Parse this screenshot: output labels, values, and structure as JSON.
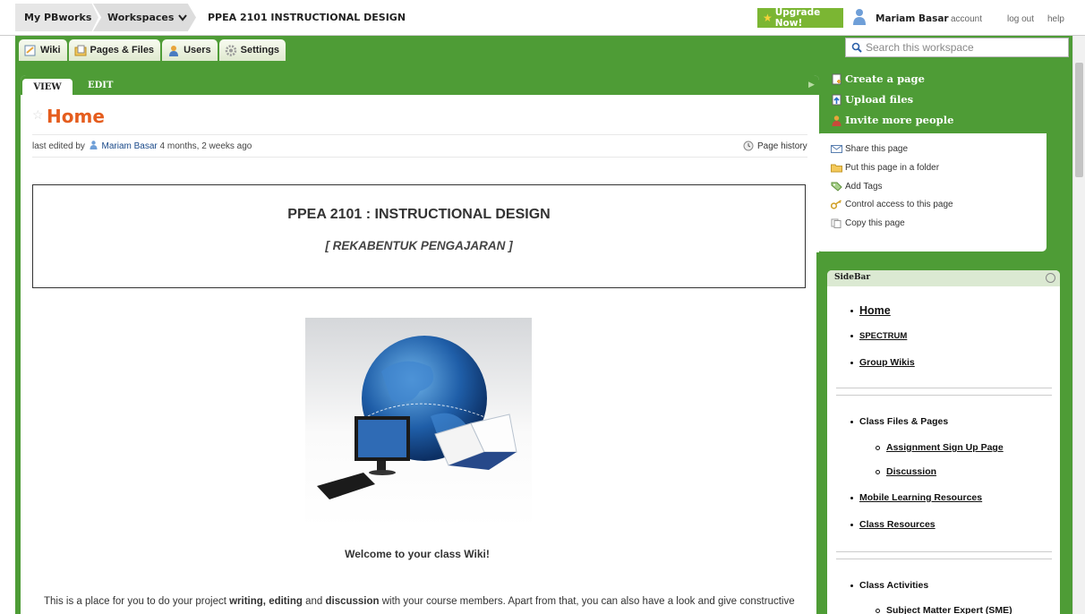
{
  "topbar": {
    "my_pbworks": "My PBworks",
    "workspaces": "Workspaces",
    "current_workspace": "PPEA 2101 INSTRUCTIONAL DESIGN",
    "upgrade": "Upgrade Now!",
    "user_name": "Mariam Basar",
    "links": {
      "account": "account",
      "logout": "log out",
      "help": "help"
    }
  },
  "nav_tabs": [
    {
      "label": "Wiki",
      "icon": "wiki-icon"
    },
    {
      "label": "Pages & Files",
      "icon": "pages-files-icon"
    },
    {
      "label": "Users",
      "icon": "users-icon"
    },
    {
      "label": "Settings",
      "icon": "settings-gear-icon"
    }
  ],
  "search": {
    "placeholder": "Search this workspace"
  },
  "page": {
    "view_tab": "VIEW",
    "edit_tab": "EDIT",
    "title": "Home",
    "last_edited": {
      "prefix": "last edited by",
      "user": "Mariam Basar",
      "when": "4 months, 2 weeks ago"
    },
    "page_history": "Page history",
    "course_title": "PPEA 2101 :  INSTRUCTIONAL DESIGN",
    "course_subtitle": "[ REKABENTUK PENGAJARAN ]",
    "welcome": "Welcome to your class Wiki!",
    "intro": {
      "p1": "This is a place for you to do your project ",
      "b1": "writing, editing",
      "p2": " and ",
      "b2": "discussion",
      "p3": " with your course members. Apart from that, you can also have a look and give constructive"
    }
  },
  "actions": {
    "create_page": "Create a page",
    "upload_files": "Upload files",
    "invite_people": "Invite more people"
  },
  "page_tools": [
    {
      "label": "Share this page",
      "icon": "share-mail-icon"
    },
    {
      "label": "Put this page in a folder",
      "icon": "folder-icon"
    },
    {
      "label": "Add Tags",
      "icon": "tag-icon"
    },
    {
      "label": "Control access to this page",
      "icon": "key-icon"
    },
    {
      "label": "Copy this page",
      "icon": "copy-icon"
    }
  ],
  "sidebar": {
    "title": "SideBar",
    "group1": [
      "Home",
      "SPECTRUM",
      "Group Wikis"
    ],
    "class_files_heading": "Class Files & Pages",
    "class_files_sub": [
      "Assignment Sign Up Page",
      "Discussion"
    ],
    "mobile": "Mobile Learning Resources",
    "class_resources": "Class Resources",
    "class_activities_heading": "Class Activities",
    "class_activities_sub": [
      "Subject Matter Expert (SME)"
    ]
  },
  "colors": {
    "frame_green": "#4e9c36",
    "title_orange": "#e55d1e",
    "upgrade_green": "#7bb633"
  }
}
